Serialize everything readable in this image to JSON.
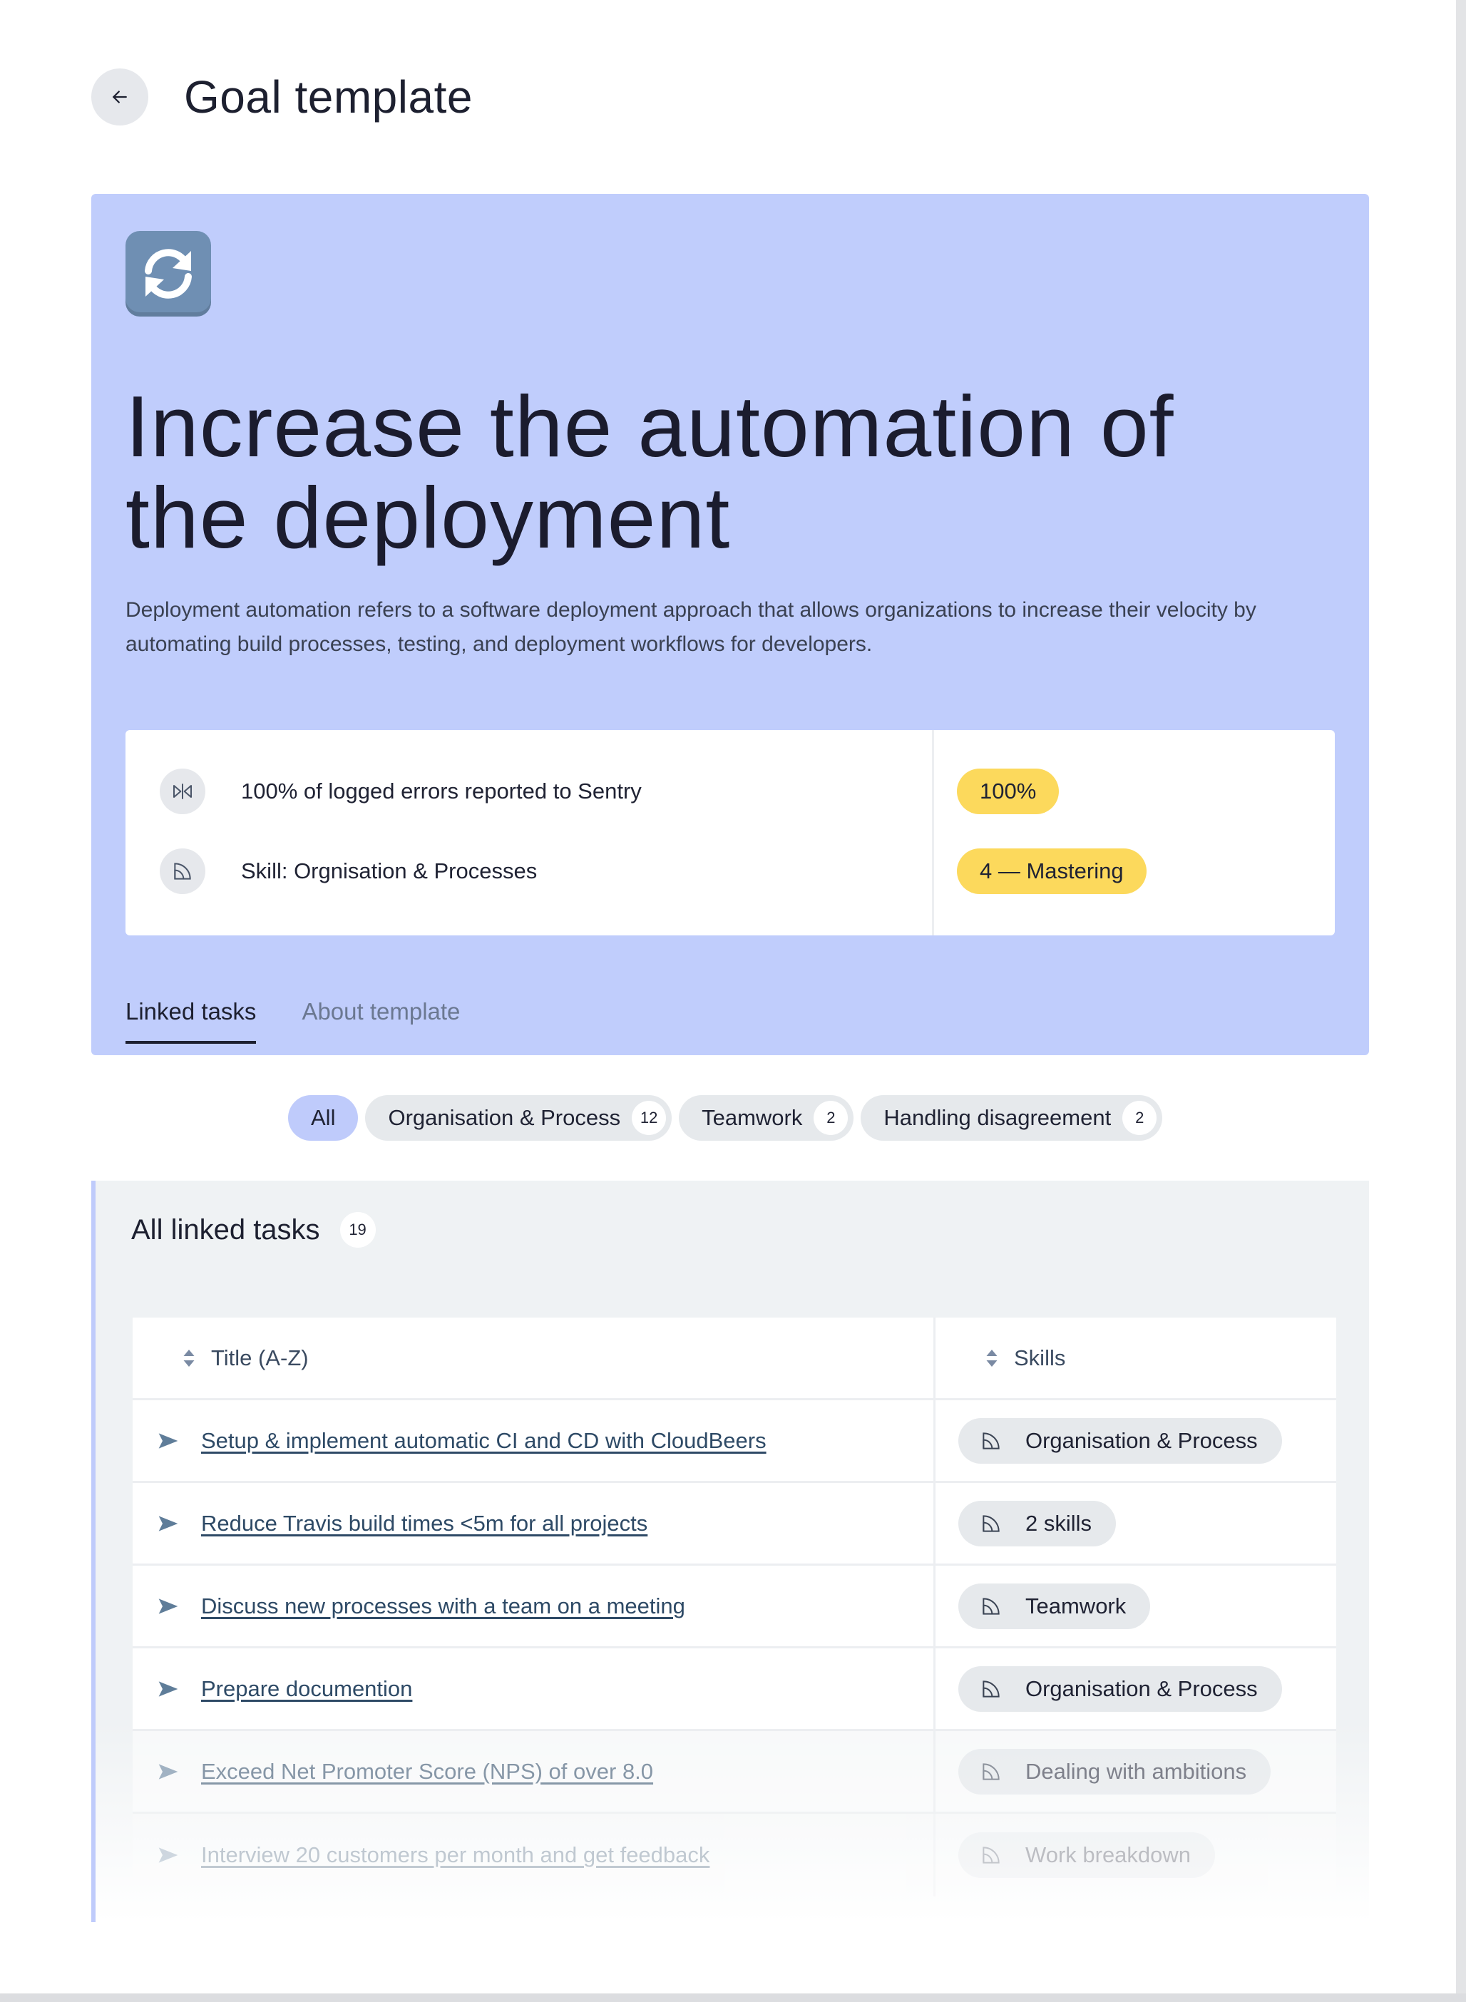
{
  "header": {
    "title": "Goal template",
    "back_icon": "arrow-left-icon"
  },
  "hero": {
    "icon": "refresh-arrows-icon",
    "title": "Increase the automation of the deployment",
    "description": "Deployment automation refers to a software deployment approach that allows organizations to increase their velocity by automating build processes, testing, and deployment workflows for developers.",
    "background_color": "#c0cdfc",
    "metrics": [
      {
        "icon": "measure-icon",
        "text": "100% of logged errors reported to Sentry",
        "value": "100%"
      },
      {
        "icon": "skill-quarter-icon",
        "text": "Skill: Orgnisation & Processes",
        "value": "4 — Mastering"
      }
    ],
    "tabs": [
      {
        "label": "Linked tasks",
        "active": true
      },
      {
        "label": "About template",
        "active": false
      }
    ]
  },
  "filters": [
    {
      "label": "All",
      "selected": true
    },
    {
      "label": "Organisation & Process",
      "count": "12"
    },
    {
      "label": "Teamwork",
      "count": "2"
    },
    {
      "label": "Handling disagreement",
      "count": "2"
    }
  ],
  "tasks": {
    "heading": "All linked tasks",
    "count": "19",
    "columns": {
      "title": "Title (A-Z)",
      "skills": "Skills"
    },
    "rows": [
      {
        "title": "Setup & implement automatic CI and CD with CloudBeers",
        "skill": "Organisation & Process"
      },
      {
        "title": "Reduce Travis build times <5m for all projects",
        "skill": "2 skills"
      },
      {
        "title": "Discuss new processes with a team on a meeting",
        "skill": "Teamwork"
      },
      {
        "title": "Prepare documention",
        "skill": "Organisation & Process"
      },
      {
        "title": "Exceed Net Promoter Score (NPS) of over 8.0",
        "skill": "Dealing with ambitions"
      },
      {
        "title": "Interview 20 customers per month and get feedback",
        "skill": "Work breakdown"
      }
    ]
  },
  "colors": {
    "accent": "#bfcbfb",
    "pill_yellow": "#fcd95c",
    "link": "#2e4a66"
  }
}
